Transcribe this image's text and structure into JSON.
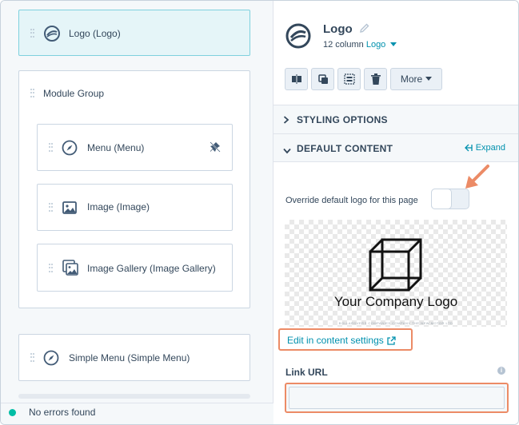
{
  "left_panel": {
    "modules": [
      {
        "label": "Logo (Logo)",
        "icon": "logo-icon",
        "selected": true
      },
      {
        "label": "Module Group",
        "icon": "none"
      },
      {
        "label": "Menu (Menu)",
        "icon": "compass-icon"
      },
      {
        "label": "Image (Image)",
        "icon": "image-icon"
      },
      {
        "label": "Image Gallery (Image Gallery)",
        "icon": "gallery-icon"
      },
      {
        "label": "Simple Menu (Simple Menu)",
        "icon": "compass-icon"
      }
    ],
    "status_text": "No errors found"
  },
  "right_panel": {
    "title": "Logo",
    "subtitle_prefix": "12 column",
    "subtitle_link": "Logo",
    "toolbar": {
      "more_label": "More"
    },
    "sections": {
      "styling": "STYLING OPTIONS",
      "default": "DEFAULT CONTENT",
      "expand": "Expand"
    },
    "override_label": "Override default logo for this page",
    "override_toggle_on": false,
    "preview": {
      "company_text": "Your Company Logo",
      "faint_text": "BOLLARDVERS COMPANIES COMPANY THE NEW MOTOR LTD"
    },
    "edit_link": "Edit in content settings",
    "link_url_label": "Link URL",
    "link_url_value": ""
  },
  "colors": {
    "accent": "#0091ae",
    "highlight": "#ec8b66",
    "selected_bg": "#e5f5f8",
    "status_ok": "#00bda5"
  }
}
